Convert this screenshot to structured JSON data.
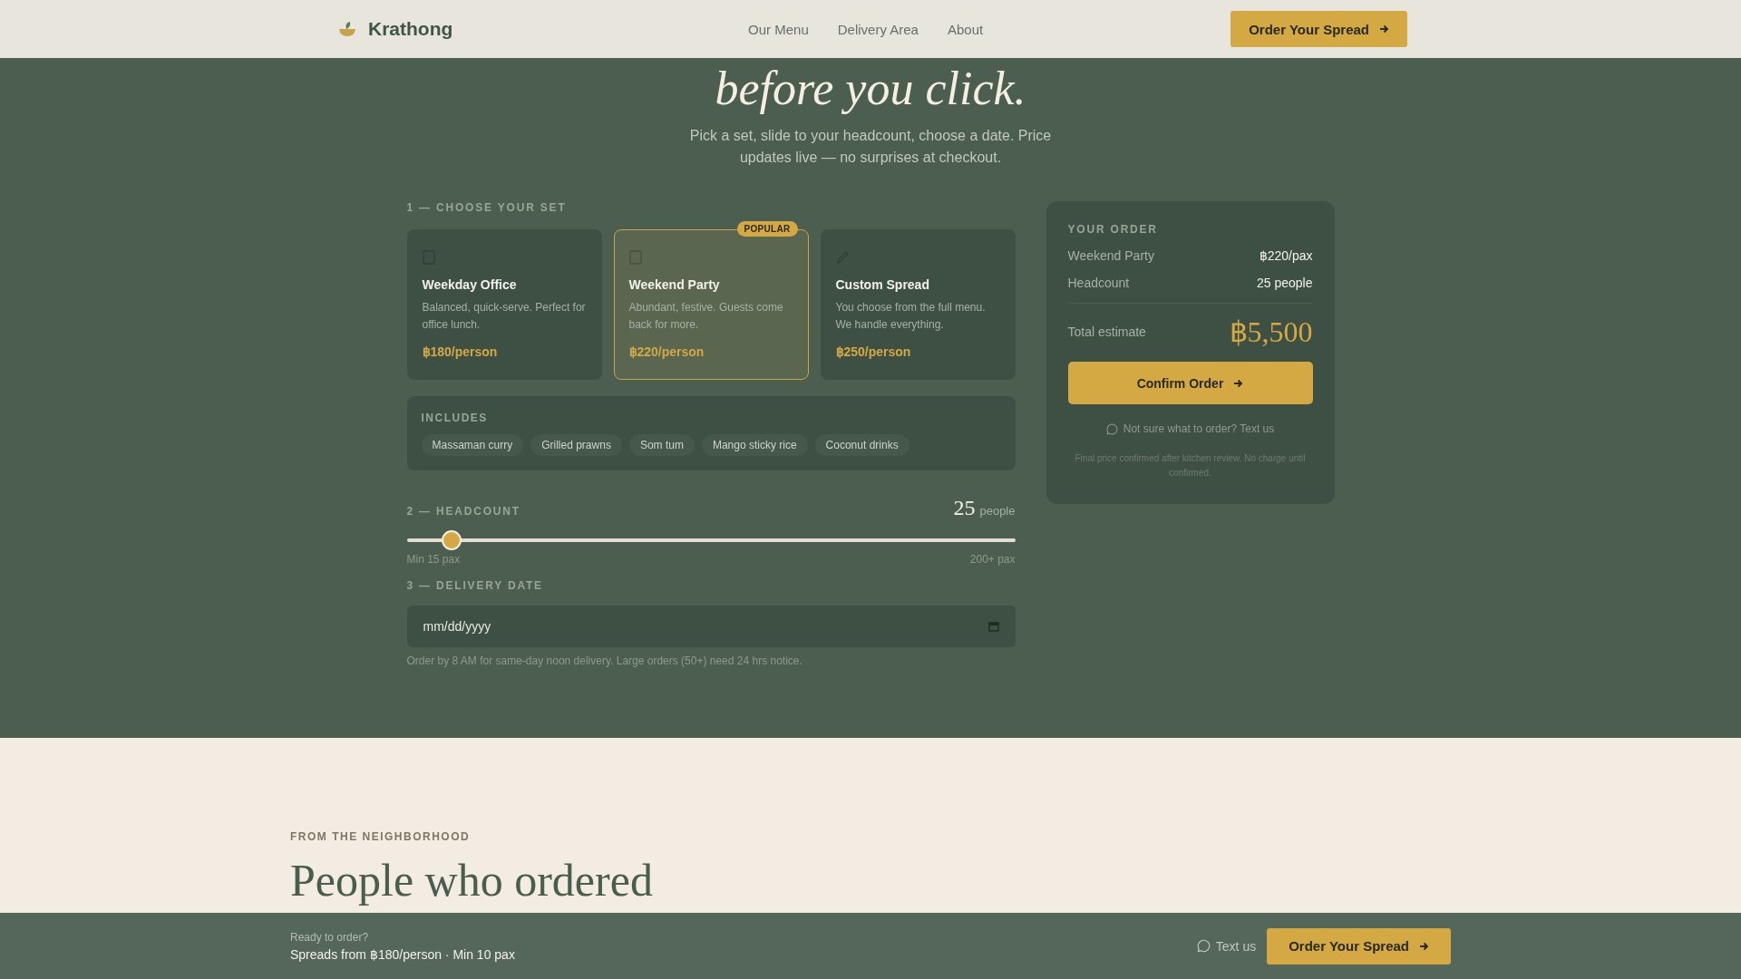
{
  "header": {
    "brand": "Krathong",
    "nav": [
      {
        "label": "Our Menu"
      },
      {
        "label": "Delivery Area"
      },
      {
        "label": "About"
      }
    ],
    "cta": "Order Your Spread"
  },
  "hero": {
    "title": "before you click.",
    "subtitle": "Pick a set, slide to your headcount, choose a date. Price updates live — no surprises at checkout."
  },
  "sets": {
    "heading": "1 — CHOOSE YOUR SET",
    "items": [
      {
        "kind": "box",
        "name": "Weekday Office",
        "description": "Balanced, quick-serve. Perfect for office lunch.",
        "price": "฿180/person",
        "selected": false
      },
      {
        "kind": "box",
        "name": "Weekend Party",
        "description": "Abundant, festive. Guests come back for more.",
        "price": "฿220/person",
        "selected": true,
        "badge": "POPULAR"
      },
      {
        "kind": "pencil",
        "name": "Custom Spread",
        "description": "You choose from the full menu. We handle everything.",
        "price": "฿250/person",
        "selected": false
      }
    ]
  },
  "includes": {
    "heading": "INCLUDES",
    "items": [
      "Massaman curry",
      "Grilled prawns",
      "Som tum",
      "Mango sticky rice",
      "Coconut drinks"
    ]
  },
  "headcount": {
    "heading": "2 — HEADCOUNT",
    "value": "25",
    "unit": "people",
    "level": 0.06,
    "min_label": "Min 15 pax",
    "max_label": "200+ pax"
  },
  "delivery": {
    "heading": "3 — DELIVERY DATE",
    "placeholder": "mm/dd/yyyy",
    "note": "Order by 8 AM for same-day noon delivery. Large orders (50+) need 24 hrs notice."
  },
  "order": {
    "heading": "YOUR ORDER",
    "lines": [
      {
        "label": "Weekend Party",
        "value": "฿220/pax"
      },
      {
        "label": "Headcount",
        "value": "25 people"
      }
    ],
    "total_label": "Total estimate",
    "total": "฿5,500",
    "confirm": "Confirm Order",
    "help": "Not sure what to order? Text us",
    "fineprint": "Final price confirmed after kitchen review. No charge until confirmed."
  },
  "testimonials": {
    "eyebrow": "FROM THE NEIGHBORHOOD",
    "title": "People who ordered"
  },
  "bottom_bar": {
    "prompt": "Ready to order?",
    "summary": "Spreads from ฿180/person · Min 10 pax",
    "text_link": "Text us",
    "cta": "Order Your Spread"
  }
}
